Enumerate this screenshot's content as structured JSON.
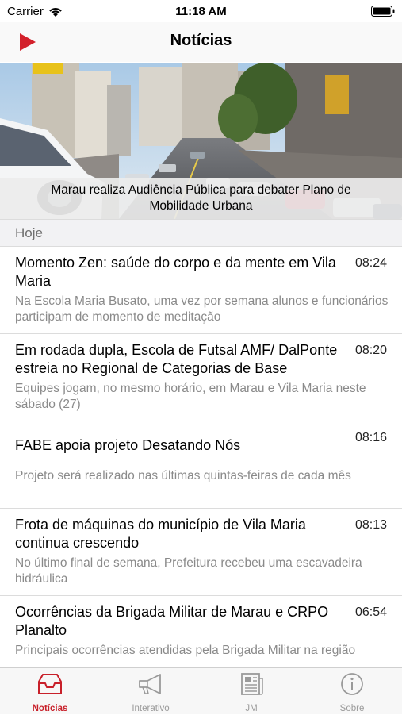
{
  "status": {
    "carrier": "Carrier",
    "time": "11:18 AM"
  },
  "nav": {
    "title": "Notícias"
  },
  "hero": {
    "caption": "Marau realiza Audiência Pública para debater Plano de Mobilidade Urbana"
  },
  "section": {
    "label": "Hoje"
  },
  "news": [
    {
      "title": "Momento Zen: saúde do corpo e da mente em Vila Maria",
      "time": "08:24",
      "summary": "Na Escola Maria Busato, uma vez por semana alunos e funcionários participam de momento de meditação"
    },
    {
      "title": "Em rodada dupla, Escola de Futsal AMF/ DalPonte estreia no Regional de Categorias de Base",
      "time": "08:20",
      "summary": "Equipes jogam, no mesmo horário, em Marau e Vila Maria neste sábado (27)"
    },
    {
      "title": "FABE apoia projeto Desatando Nós",
      "time": "08:16",
      "summary": "Projeto será realizado nas últimas quintas-feiras de cada mês"
    },
    {
      "title": "Frota de máquinas do município de Vila Maria continua crescendo",
      "time": "08:13",
      "summary": "No último final de semana, Prefeitura recebeu uma escavadeira hidráulica"
    },
    {
      "title": "Ocorrências da Brigada Militar de Marau e CRPO Planalto",
      "time": "06:54",
      "summary": "Principais ocorrências atendidas pela Brigada Militar na região"
    }
  ],
  "tabs": [
    {
      "label": "Notícias",
      "icon": "inbox-icon",
      "active": true
    },
    {
      "label": "Interativo",
      "icon": "megaphone-icon",
      "active": false
    },
    {
      "label": "JM",
      "icon": "newspaper-icon",
      "active": false
    },
    {
      "label": "Sobre",
      "icon": "info-icon",
      "active": false
    }
  ],
  "colors": {
    "accent": "#c8202a",
    "inactive": "#9a9a9a"
  }
}
